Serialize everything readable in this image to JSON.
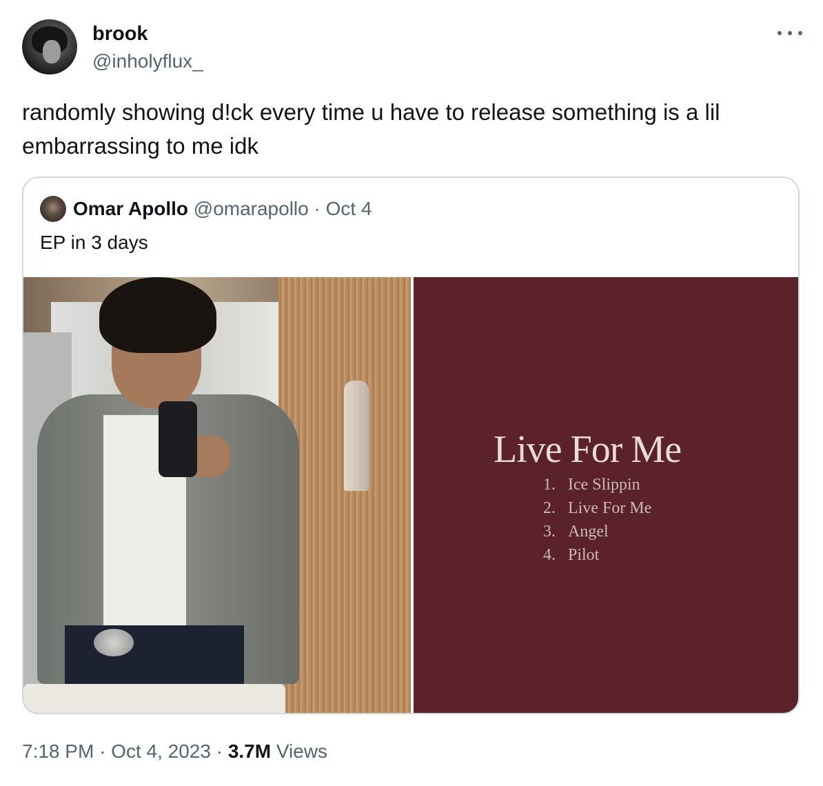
{
  "author": {
    "name": "brook",
    "handle": "@inholyflux_"
  },
  "more_icon": "more-horizontal-icon",
  "tweet": {
    "text": "randomly showing d!ck every time u have to release something is a lil embarrassing to me idk"
  },
  "quoted": {
    "name": "Omar Apollo",
    "handle": "@omarapollo",
    "separator": "·",
    "date": "Oct 4",
    "text": "EP in 3 days",
    "cover": {
      "title": "Live For Me",
      "tracks": [
        {
          "num": "1.",
          "title": "Ice Slippin"
        },
        {
          "num": "2.",
          "title": "Live For Me"
        },
        {
          "num": "3.",
          "title": "Angel"
        },
        {
          "num": "4.",
          "title": "Pilot"
        }
      ]
    }
  },
  "meta": {
    "time": "7:18 PM",
    "sep1": "·",
    "date": "Oct 4, 2023",
    "sep2": "·",
    "views_count": "3.7M",
    "views_label": "Views"
  },
  "colors": {
    "text_primary": "#0f1419",
    "text_secondary": "#536471",
    "border": "#cfd9de",
    "cover_bg": "#5b222a"
  }
}
